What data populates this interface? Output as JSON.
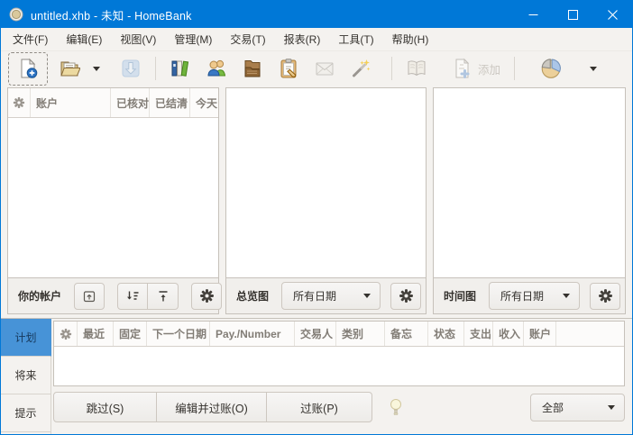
{
  "window": {
    "title": "untitled.xhb - 未知 - HomeBank"
  },
  "colors": {
    "titlebar": "#0078d7",
    "active_tab": "#4793d7",
    "toolbar_bg": "#f4f2ef"
  },
  "menu": {
    "items": [
      "文件(F)",
      "编辑(E)",
      "视图(V)",
      "管理(M)",
      "交易(T)",
      "报表(R)",
      "工具(T)",
      "帮助(H)"
    ]
  },
  "toolbar": {
    "add_label": "添加"
  },
  "accounts": {
    "columns": [
      "账户",
      "已核对",
      "已结清",
      "今天"
    ],
    "footer_label": "你的帐户"
  },
  "overview": {
    "label": "总览图",
    "range": "所有日期"
  },
  "trendtime": {
    "label": "时间图",
    "range": "所有日期"
  },
  "bottom": {
    "tabs": [
      "计划",
      "将来",
      "提示"
    ],
    "columns": [
      "最近",
      "固定",
      "下一个日期",
      "Pay./Number",
      "交易人",
      "类别",
      "备忘",
      "状态",
      "支出",
      "收入",
      "账户"
    ],
    "buttons": {
      "skip": "跳过(S)",
      "edit_post": "编辑并过账(O)",
      "post": "过账(P)"
    },
    "filter": "全部"
  }
}
